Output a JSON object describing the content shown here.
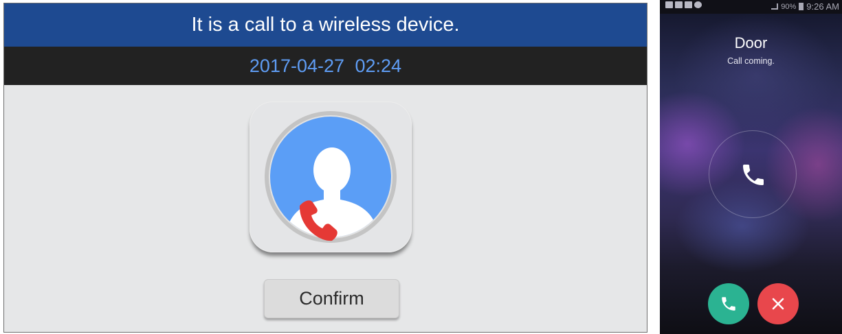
{
  "monitor": {
    "title": "It is a call to a wireless device.",
    "date": "2017-04-27  02:24",
    "confirm_label": "Confirm",
    "colors": {
      "title_bar": "#1e4a91",
      "date_text": "#5f9df5",
      "avatar_bg": "#5b9ef6",
      "handset": "#e53935"
    }
  },
  "phone": {
    "status": {
      "battery": "90%",
      "time": "9:26 AM"
    },
    "caller_name": "Door",
    "caller_status": "Call coming.",
    "colors": {
      "answer": "#2bb392",
      "decline": "#e8474c"
    }
  }
}
